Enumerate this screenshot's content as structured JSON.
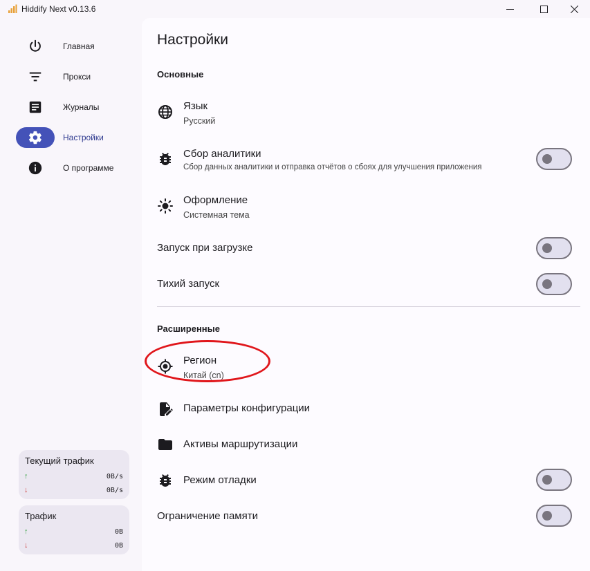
{
  "window": {
    "title": "Hiddify Next v0.13.6"
  },
  "sidebar": {
    "items": [
      {
        "label": "Главная",
        "icon": "power-icon"
      },
      {
        "label": "Прокси",
        "icon": "filter-icon"
      },
      {
        "label": "Журналы",
        "icon": "article-icon"
      },
      {
        "label": "Настройки",
        "icon": "gear-icon",
        "active": true
      },
      {
        "label": "О программе",
        "icon": "info-icon"
      }
    ],
    "current_traffic": {
      "title": "Текущий трафик",
      "up_arrow": "↑",
      "up": "0B/s",
      "down_arrow": "↓",
      "down": "0B/s"
    },
    "traffic": {
      "title": "Трафик",
      "up_arrow": "↑",
      "up": "0B",
      "down_arrow": "↓",
      "down": "0B"
    }
  },
  "main": {
    "title": "Настройки",
    "basic": {
      "title": "Основные",
      "language": {
        "title": "Язык",
        "value": "Русский",
        "icon": "globe-icon"
      },
      "analytics": {
        "title": "Сбор аналитики",
        "subtitle": "Сбор данных аналитики и отправка отчётов о сбоях для улучшения приложения",
        "icon": "bug-icon",
        "enabled": false
      },
      "theme": {
        "title": "Оформление",
        "value": "Системная тема",
        "icon": "brightness-icon"
      },
      "autostart": {
        "title": "Запуск при загрузке",
        "enabled": false
      },
      "silent_start": {
        "title": "Тихий запуск",
        "enabled": false
      }
    },
    "advanced": {
      "title": "Расширенные",
      "region": {
        "title": "Регион",
        "value": "Китай (cn)",
        "icon": "location-icon"
      },
      "config_options": {
        "title": "Параметры конфигурации",
        "icon": "edit-document-icon"
      },
      "routing_assets": {
        "title": "Активы маршрутизации",
        "icon": "folder-icon"
      },
      "debug_mode": {
        "title": "Режим отладки",
        "icon": "bug-icon",
        "enabled": false
      },
      "memory_limit": {
        "title": "Ограничение памяти",
        "enabled": false
      }
    }
  },
  "colors": {
    "accent": "#4452b8",
    "highlight": "#e0161b",
    "background": "#f9f6fb",
    "card": "#ebe7f1"
  }
}
